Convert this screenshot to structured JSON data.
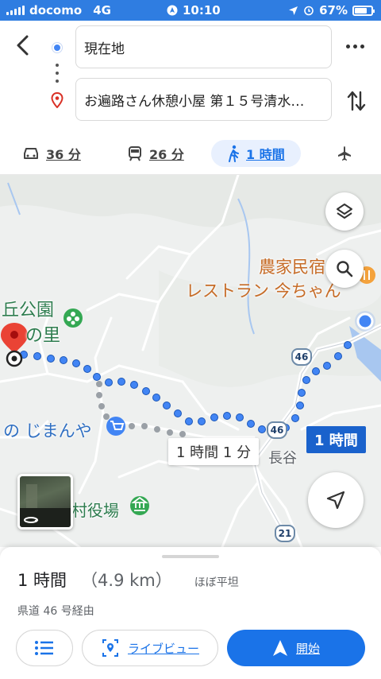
{
  "status_bar": {
    "carrier": "docomo",
    "network": "4G",
    "time": "10:10",
    "battery": "67%"
  },
  "directions": {
    "origin": "現在地",
    "destination": "お遍路さん休憩小屋 第１５号清水…"
  },
  "travel_modes": [
    {
      "icon": "car-icon",
      "label": "36 分",
      "selected": false
    },
    {
      "icon": "train-icon",
      "label": "26 分",
      "selected": false
    },
    {
      "icon": "walk-icon",
      "label": "1 時間",
      "selected": true
    },
    {
      "icon": "plane-icon",
      "label": "",
      "selected": false
    }
  ],
  "map": {
    "labels": {
      "farm_restaurant_line1": "農家民宿",
      "farm_restaurant_line2": "レストラン 今ちゃん",
      "park_line1": "丘公園",
      "park_line2": "の里",
      "shop": "の じまんや",
      "village_office": "村役場",
      "place_chotani": "長谷"
    },
    "route_time_selected": "1 時間",
    "route_time_alternative": "1 時間 1 分",
    "road_numbers": {
      "r46a": "46",
      "r46b": "46",
      "r21": "21"
    },
    "colors": {
      "route": "#4285f4",
      "alt_route": "#9aa0a6",
      "dest_pin": "#ea4335"
    }
  },
  "summary": {
    "duration": "1 時間",
    "distance": "（4.9 km）",
    "terrain": "ほぼ平坦",
    "via": "県道 46 号経由"
  },
  "actions": {
    "live_view": "ライブビュー",
    "start": "開始"
  }
}
